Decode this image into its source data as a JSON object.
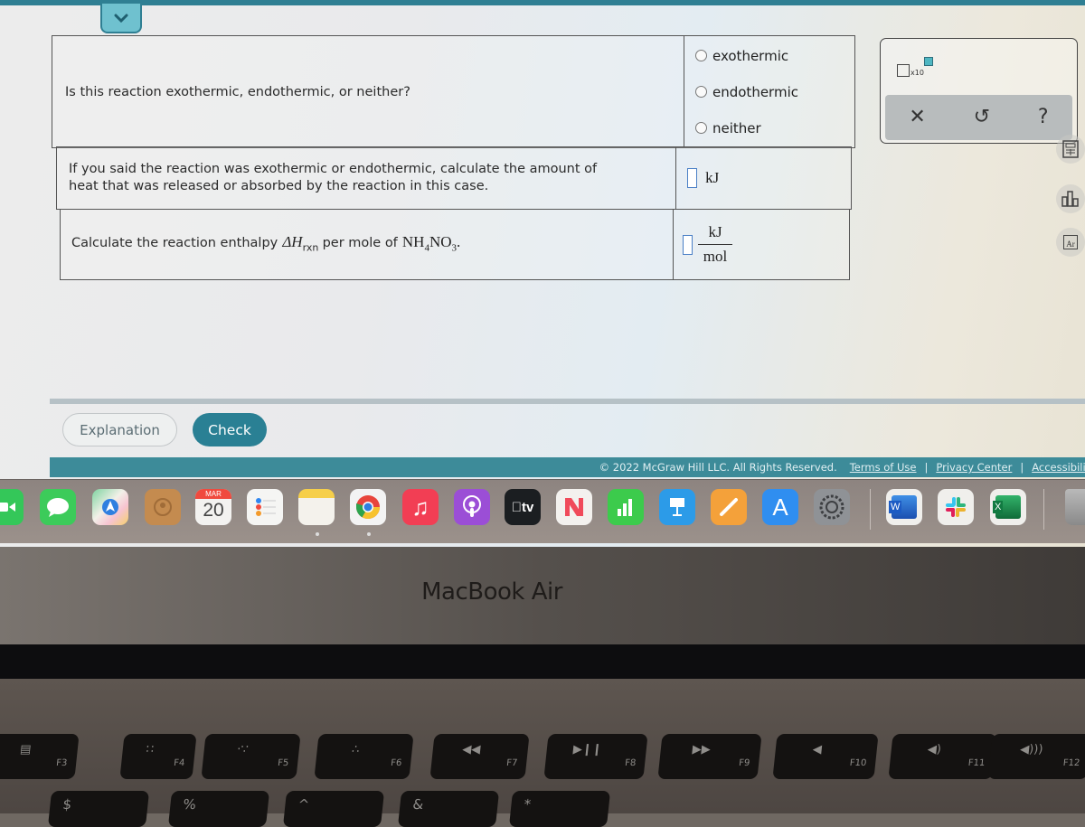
{
  "question_rows": [
    {
      "prompt": "Is this reaction exothermic, endothermic, or neither?",
      "options": [
        "exothermic",
        "endothermic",
        "neither"
      ],
      "selected": null
    },
    {
      "prompt_line1": "If you said the reaction was exothermic or endothermic, calculate the amount of",
      "prompt_line2": "heat that was released or absorbed by the reaction in this case.",
      "answer_value": "",
      "unit": "kJ"
    },
    {
      "prompt_prefix": "Calculate the reaction enthalpy",
      "delta_h": "ΔH",
      "rxn_sub": "rxn",
      "prompt_mid": "per mole of",
      "formula_nh": "NH",
      "formula_sub1": "4",
      "formula_no": "NO",
      "formula_sub2": "3",
      "formula_end": ".",
      "answer_value": "",
      "unit_numerator": "kJ",
      "unit_denominator": "mol"
    }
  ],
  "tools": {
    "x10_label": "x10",
    "clear_glyph": "✕",
    "undo_glyph": "↺",
    "help_glyph": "?",
    "side_tools": [
      "calculator-icon",
      "bar-chart-icon",
      "periodic-table-icon"
    ],
    "periodic_label": "Ar"
  },
  "buttons": {
    "explanation": "Explanation",
    "check": "Check"
  },
  "footer": {
    "copyright": "© 2022 McGraw Hill LLC. All Rights Reserved.",
    "terms": "Terms of Use",
    "privacy": "Privacy Center",
    "accessibility": "Accessibility",
    "separator": "|"
  },
  "dock": {
    "calendar_month": "MAR",
    "calendar_day": "20",
    "tv_label": "tv",
    "word_label": "W",
    "excel_label": "X"
  },
  "laptop": {
    "model": "MacBook Air",
    "fkeys": [
      {
        "label": "F3",
        "glyph": "▤"
      },
      {
        "label": "F4",
        "glyph": "∷"
      },
      {
        "label": "F5",
        "glyph": "‧∵"
      },
      {
        "label": "F6",
        "glyph": "∴"
      },
      {
        "label": "F7",
        "glyph": "◀◀"
      },
      {
        "label": "F8",
        "glyph": "▶❙❙"
      },
      {
        "label": "F9",
        "glyph": "▶▶"
      },
      {
        "label": "F10",
        "glyph": "◀"
      },
      {
        "label": "F11",
        "glyph": "◀)"
      },
      {
        "label": "F12",
        "glyph": "◀)))"
      }
    ],
    "numkeys": [
      "$",
      "%",
      "^",
      "&",
      "*"
    ]
  },
  "colors": {
    "accent": "#2a8094",
    "footer_bar": "#3d8b99",
    "answer_box_border": "#4a7fc6"
  }
}
